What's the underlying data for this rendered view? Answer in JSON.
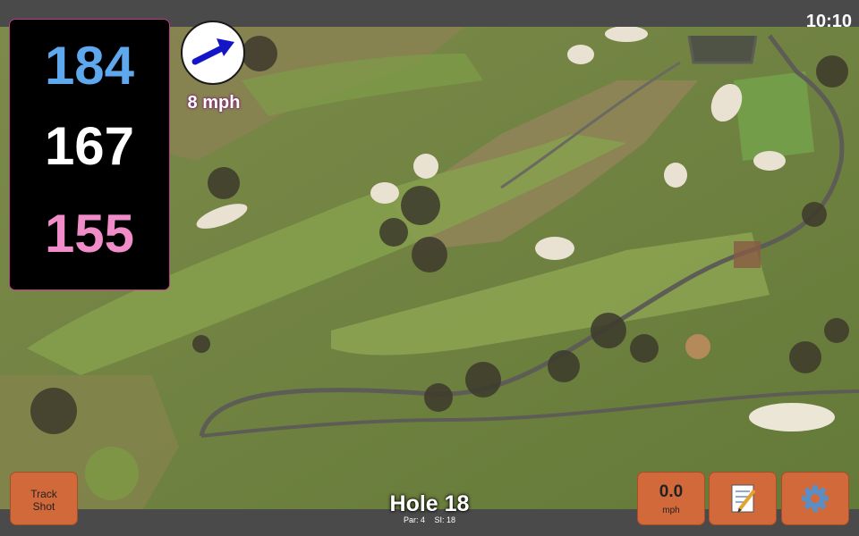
{
  "status": {
    "time": "10:10"
  },
  "distances": {
    "back": "184",
    "middle": "167",
    "front": "155"
  },
  "wind": {
    "speed": "8 mph",
    "direction_icon": "arrow-icon"
  },
  "hole": {
    "title": "Hole 18",
    "par": "Par: 4",
    "si": "SI: 18"
  },
  "buttons": {
    "track_line1": "Track",
    "track_line2": "Shot",
    "speed_value": "0.0",
    "speed_unit": "mph",
    "notes_icon": "memo-icon",
    "settings_icon": "gear-icon"
  },
  "colors": {
    "back": "#5fa8ee",
    "middle": "#ffffff",
    "front": "#f08cc7",
    "button": "#d2693a"
  }
}
